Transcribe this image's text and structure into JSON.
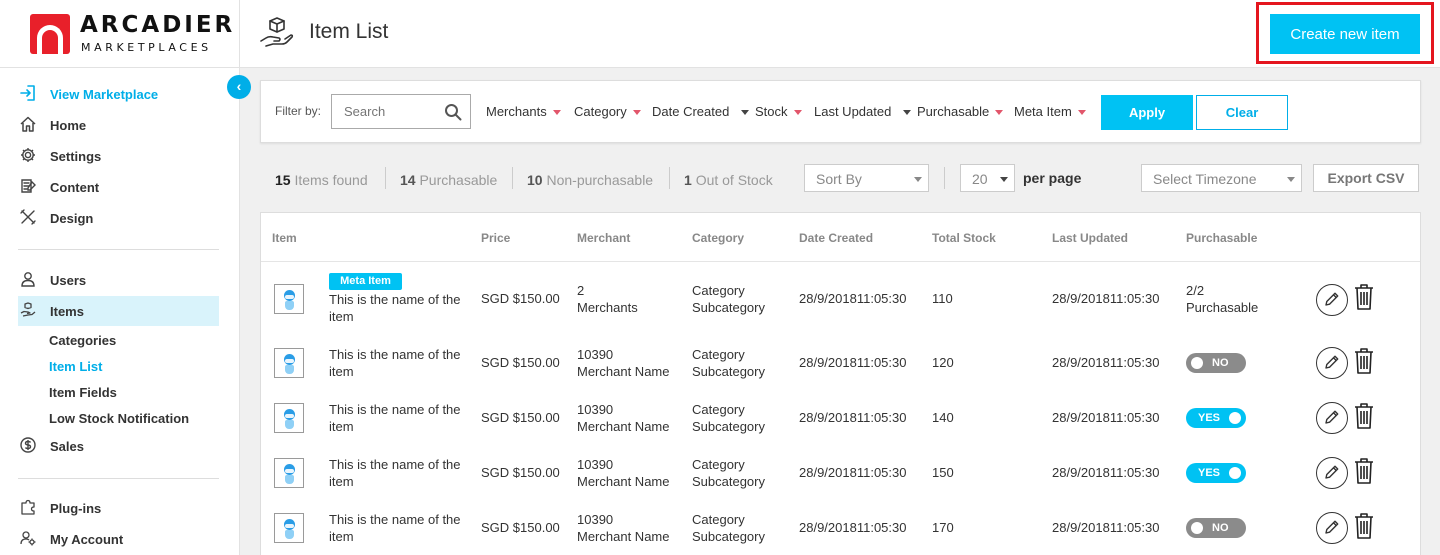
{
  "brand": {
    "name_line1": "ARCADIER",
    "name_line2": "MARKETPLACES",
    "accent": "#00c2f3",
    "logo_red": "#e8202a"
  },
  "header": {
    "title": "Item List",
    "create_button": "Create new item"
  },
  "sidebar": {
    "items": [
      {
        "label": "View Marketplace",
        "icon": "enter-icon"
      },
      {
        "label": "Home",
        "icon": "home-icon"
      },
      {
        "label": "Settings",
        "icon": "gear-icon"
      },
      {
        "label": "Content",
        "icon": "content-icon"
      },
      {
        "label": "Design",
        "icon": "design-icon"
      },
      {
        "label": "Users",
        "icon": "user-icon"
      },
      {
        "label": "Items",
        "icon": "items-icon"
      },
      {
        "label": "Sales",
        "icon": "dollar-icon"
      },
      {
        "label": "Plug-ins",
        "icon": "puzzle-icon"
      },
      {
        "label": "My Account",
        "icon": "account-icon"
      }
    ],
    "sub_items": [
      "Categories",
      "Item List",
      "Item Fields",
      "Low Stock Notification"
    ]
  },
  "filters": {
    "label": "Filter by:",
    "search_placeholder": "Search",
    "dropdowns": [
      "Merchants",
      "Category",
      "Date Created",
      "Stock",
      "Last Updated",
      "Purchasable",
      "Meta Item"
    ],
    "apply": "Apply",
    "clear": "Clear"
  },
  "stats": {
    "found_count": "15",
    "found_label": "Items found",
    "purchasable_count": "14",
    "purchasable_label": "Purchasable",
    "nonpurchasable_count": "10",
    "nonpurchasable_label": "Non-purchasable",
    "outofstock_count": "1",
    "outofstock_label": "Out of Stock",
    "sort_by": "Sort By",
    "per_page_value": "20",
    "per_page_label": "per page",
    "timezone": "Select Timezone",
    "export": "Export CSV"
  },
  "table": {
    "columns": [
      "Item",
      "Price",
      "Merchant",
      "Category",
      "Date Created",
      "Total Stock",
      "Last Updated",
      "Purchasable"
    ],
    "rows": [
      {
        "badge": "Meta Item",
        "name1": "This is the name of the",
        "name2": "item",
        "price": "SGD $150.00",
        "merchant1": "2",
        "merchant2": "Merchants",
        "category1": "Category",
        "category2": "Subcategory",
        "date_created": "28/9/201811:05:30",
        "stock": "110",
        "last_updated": "28/9/201811:05:30",
        "purchasable_text1": "2/2",
        "purchasable_text2": "Purchasable"
      },
      {
        "name1": "This is the name of the",
        "name2": "item",
        "price": "SGD $150.00",
        "merchant1": "10390",
        "merchant2": "Merchant Name",
        "category1": "Category",
        "category2": "Subcategory",
        "date_created": "28/9/201811:05:30",
        "stock": "120",
        "last_updated": "28/9/201811:05:30",
        "toggle": "NO"
      },
      {
        "name1": "This is the name of the",
        "name2": "item",
        "price": "SGD $150.00",
        "merchant1": "10390",
        "merchant2": "Merchant Name",
        "category1": "Category",
        "category2": "Subcategory",
        "date_created": "28/9/201811:05:30",
        "stock": "140",
        "last_updated": "28/9/201811:05:30",
        "toggle": "YES"
      },
      {
        "name1": "This is the name of the",
        "name2": "item",
        "price": "SGD $150.00",
        "merchant1": "10390",
        "merchant2": "Merchant Name",
        "category1": "Category",
        "category2": "Subcategory",
        "date_created": "28/9/201811:05:30",
        "stock": "150",
        "last_updated": "28/9/201811:05:30",
        "toggle": "YES"
      },
      {
        "name1": "This is the name of the",
        "name2": "item",
        "price": "SGD $150.00",
        "merchant1": "10390",
        "merchant2": "Merchant Name",
        "category1": "Category",
        "category2": "Subcategory",
        "date_created": "28/9/201811:05:30",
        "stock": "170",
        "last_updated": "28/9/201811:05:30",
        "toggle": "NO"
      }
    ]
  }
}
